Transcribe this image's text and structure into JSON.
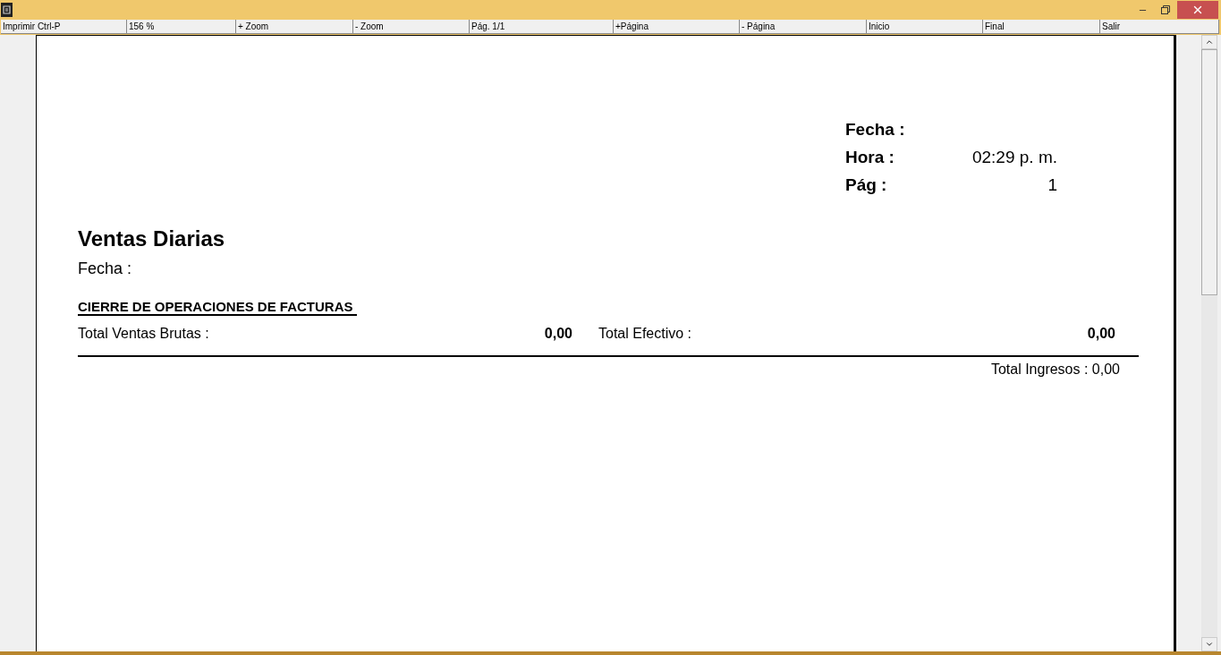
{
  "toolbar": [
    {
      "label": "Imprimir Ctrl-P"
    },
    {
      "label": "156 %"
    },
    {
      "label": "+ Zoom"
    },
    {
      "label": "- Zoom"
    },
    {
      "label": "Pág. 1/1"
    },
    {
      "label": "+Página"
    },
    {
      "label": "- Página"
    },
    {
      "label": "Inicio"
    },
    {
      "label": "Final"
    },
    {
      "label": "Salir"
    }
  ],
  "header": [
    {
      "label": "Fecha :"
    },
    {
      "label": "Hora :",
      "value": "02:29 p. m."
    },
    {
      "label": "Pág :",
      "value": "1"
    }
  ],
  "report": {
    "title": "Ventas Diarias",
    "date_label": "Fecha :",
    "section": "CIERRE DE OPERACIONES DE FACTURAS",
    "totals": [
      {
        "label": "Total Ventas Brutas :",
        "value": "0,00"
      },
      {
        "label": "Total Efectivo :",
        "value": "0,00"
      }
    ],
    "grand_total": "Total Ingresos : 0,00"
  }
}
